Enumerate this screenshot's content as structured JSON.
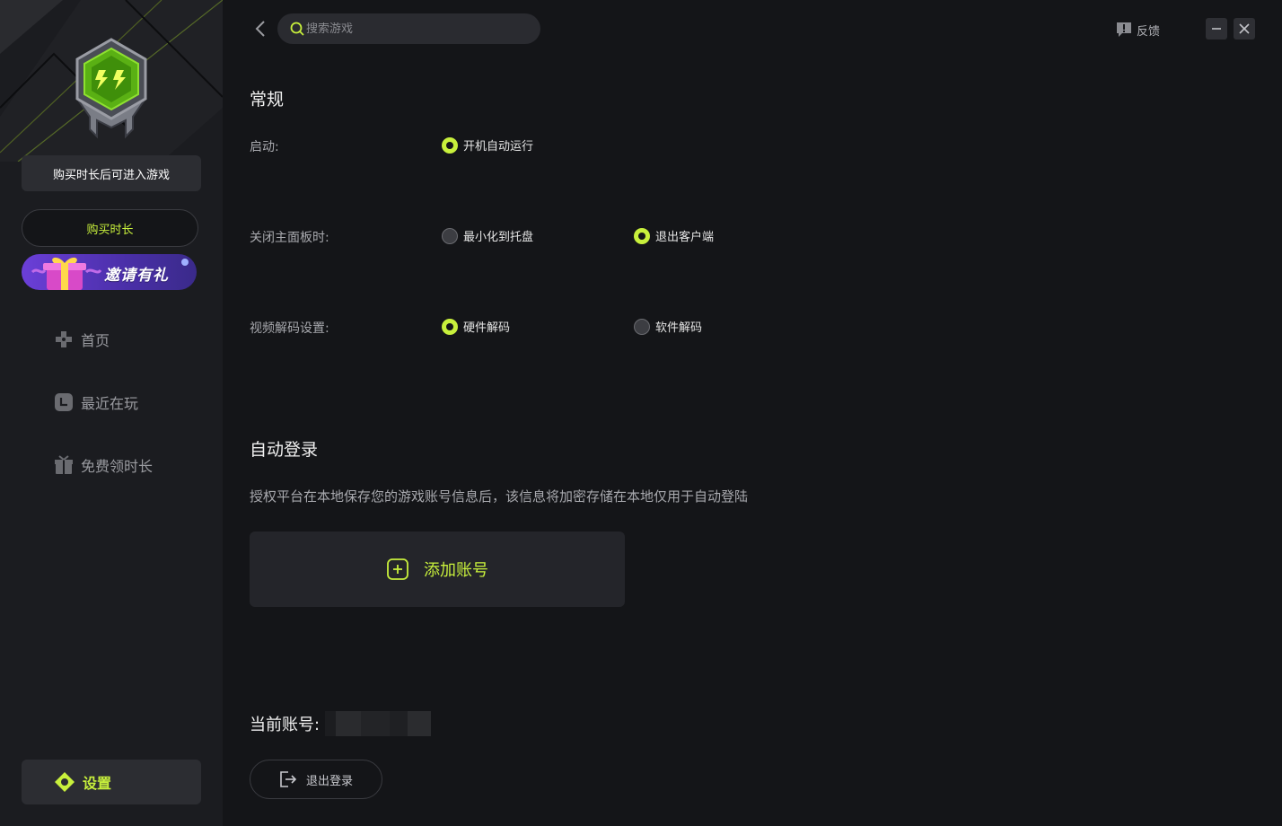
{
  "sidebar": {
    "notice": "购买时长后可进入游戏",
    "buy_label": "购买时长",
    "invite_label": "邀请有礼",
    "nav": {
      "home": "首页",
      "recent": "最近在玩",
      "free_time": "免费领时长"
    },
    "settings_label": "设置"
  },
  "topbar": {
    "search_placeholder": "搜索游戏",
    "feedback_label": "反馈"
  },
  "general": {
    "title": "常规",
    "startup": {
      "label": "启动:",
      "options": [
        {
          "label": "开机自动运行",
          "selected": true
        }
      ]
    },
    "close_panel": {
      "label": "关闭主面板时:",
      "options": [
        {
          "label": "最小化到托盘",
          "selected": false
        },
        {
          "label": "退出客户端",
          "selected": true
        }
      ]
    },
    "video_decode": {
      "label": "视频解码设置:",
      "options": [
        {
          "label": "硬件解码",
          "selected": true
        },
        {
          "label": "软件解码",
          "selected": false
        }
      ]
    }
  },
  "auto_login": {
    "title": "自动登录",
    "description": "授权平台在本地保存您的游戏账号信息后，该信息将加密存储在本地仅用于自动登陆",
    "add_account_label": "添加账号"
  },
  "account": {
    "current_label": "当前账号:",
    "logout_label": "退出登录"
  },
  "colors": {
    "accent": "#c8f03c",
    "background": "#141518",
    "sidebar": "#1b1c20"
  }
}
